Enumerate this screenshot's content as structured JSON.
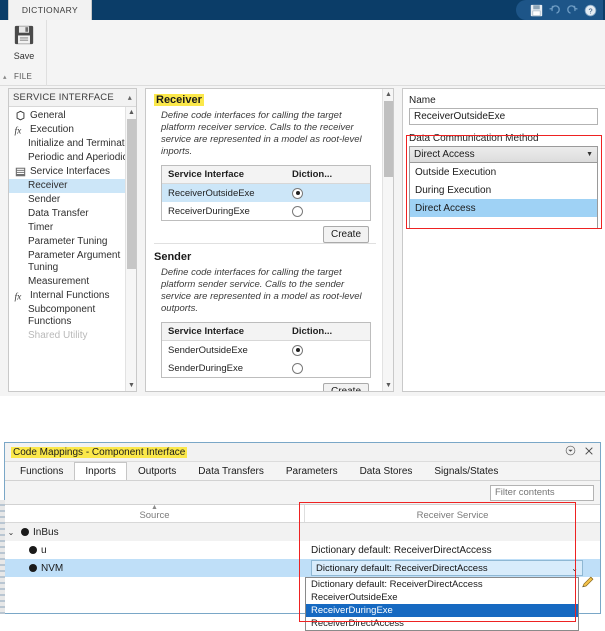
{
  "top_window": {
    "tab": {
      "label": "DICTIONARY"
    },
    "titlebar_icons": [
      "save-icon",
      "undo-icon",
      "redo-icon",
      "help-icon"
    ],
    "ribbon": {
      "save_label": "Save",
      "group_label": "FILE"
    },
    "sidebar": {
      "header": "SERVICE INTERFACE",
      "items": [
        {
          "label": "General",
          "icon": "general-icon",
          "level": 1,
          "selected": false
        },
        {
          "label": "Execution",
          "icon": "fx-icon",
          "level": 1,
          "selected": false
        },
        {
          "label": "Initialize and Terminate",
          "icon": "none",
          "level": 2,
          "selected": false
        },
        {
          "label": "Periodic and Aperiodic",
          "icon": "none",
          "level": 2,
          "selected": false
        },
        {
          "label": "Service Interfaces",
          "icon": "service-icon",
          "level": 1,
          "selected": false
        },
        {
          "label": "Receiver",
          "icon": "none",
          "level": 2,
          "selected": true
        },
        {
          "label": "Sender",
          "icon": "none",
          "level": 2,
          "selected": false
        },
        {
          "label": "Data Transfer",
          "icon": "none",
          "level": 2,
          "selected": false
        },
        {
          "label": "Timer",
          "icon": "none",
          "level": 2,
          "selected": false
        },
        {
          "label": "Parameter Tuning",
          "icon": "none",
          "level": 2,
          "selected": false
        },
        {
          "label": "Parameter Argument Tuning",
          "icon": "none",
          "level": 2,
          "selected": false
        },
        {
          "label": "Measurement",
          "icon": "none",
          "level": 2,
          "selected": false
        },
        {
          "label": "Internal Functions",
          "icon": "fx-icon",
          "level": 1,
          "selected": false
        },
        {
          "label": "Subcomponent Functions",
          "icon": "none",
          "level": 2,
          "selected": false
        },
        {
          "label": "Shared Utility",
          "icon": "none",
          "level": 2,
          "selected": false
        }
      ]
    },
    "center": {
      "receiver": {
        "title": "Receiver",
        "description": "Define code interfaces for calling the target platform receiver service. Calls to the receiver service are represented in a model as root-level inports.",
        "columns": [
          "Service Interface",
          "Diction..."
        ],
        "rows": [
          {
            "name": "ReceiverOutsideExe",
            "radio": true,
            "selected": true
          },
          {
            "name": "ReceiverDuringExe",
            "radio": false,
            "selected": false
          }
        ],
        "create_label": "Create"
      },
      "sender": {
        "title": "Sender",
        "description": "Define code interfaces for calling the target platform sender service. Calls to the sender service are represented in a model as root-level outports.",
        "columns": [
          "Service Interface",
          "Diction..."
        ],
        "rows": [
          {
            "name": "SenderOutsideExe",
            "radio": true,
            "selected": false
          },
          {
            "name": "SenderDuringExe",
            "radio": false,
            "selected": false
          }
        ],
        "create_label": "Create"
      }
    },
    "right": {
      "name_label": "Name",
      "name_value": "ReceiverOutsideExe",
      "dcm_label": "Data Communication Method",
      "dcm_value": "Direct Access",
      "dcm_options": [
        {
          "label": "Outside Execution",
          "selected": false
        },
        {
          "label": "During Execution",
          "selected": false
        },
        {
          "label": "Direct Access",
          "selected": true
        }
      ]
    }
  },
  "bottom_window": {
    "title": "Code Mappings - Component Interface",
    "header_icons": [
      "dock-icon",
      "close-icon"
    ],
    "tabs": [
      {
        "label": "Functions",
        "active": false
      },
      {
        "label": "Inports",
        "active": true
      },
      {
        "label": "Outports",
        "active": false
      },
      {
        "label": "Data Transfers",
        "active": false
      },
      {
        "label": "Parameters",
        "active": false
      },
      {
        "label": "Data Stores",
        "active": false
      },
      {
        "label": "Signals/States",
        "active": false
      }
    ],
    "filter_placeholder": "Filter contents",
    "grid": {
      "columns": [
        "Source",
        "Receiver Service"
      ],
      "rows": [
        {
          "source": "InBus",
          "level": 0,
          "expander": "⌄",
          "service": "",
          "selected": false,
          "editing": false
        },
        {
          "source": "u",
          "level": 1,
          "expander": "",
          "service": "Dictionary default: ReceiverDirectAccess",
          "selected": false,
          "editing": false
        },
        {
          "source": "NVM",
          "level": 1,
          "expander": "",
          "service": "Dictionary default: ReceiverDirectAccess",
          "selected": true,
          "editing": true
        }
      ],
      "dropdown_options": [
        {
          "label": "Dictionary default: ReceiverDirectAccess",
          "selected": false
        },
        {
          "label": "ReceiverOutsideExe",
          "selected": false
        },
        {
          "label": "ReceiverDuringExe",
          "selected": true
        },
        {
          "label": "ReceiverDirectAccess",
          "selected": false
        }
      ]
    }
  },
  "colors": {
    "titlebar": "#0b3d68",
    "highlight_yellow": "#fbe84a",
    "selection_blue": "#cce6f8",
    "dropdown_selected": "#1669c1",
    "annotation_red": "#ee2222"
  }
}
